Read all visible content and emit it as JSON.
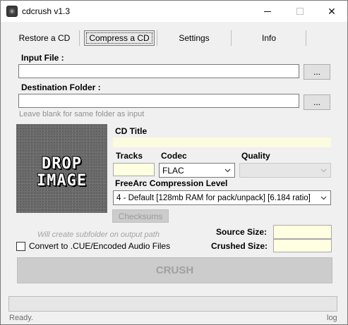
{
  "window": {
    "title": "cdcrush v1.3",
    "close_symbol": "✕"
  },
  "tabs": [
    {
      "label": "Restore a CD",
      "active": false
    },
    {
      "label": "Compress a CD",
      "active": true
    },
    {
      "label": "Settings",
      "active": false
    },
    {
      "label": "Info",
      "active": false
    }
  ],
  "input_file": {
    "label": "Input File :",
    "value": "",
    "browse_label": "..."
  },
  "destination_folder": {
    "label": "Destination Folder :",
    "value": "",
    "browse_label": "...",
    "hint": "Leave blank for same folder as input"
  },
  "drop_image": {
    "text_line1": "DROP",
    "text_line2": "IMAGE"
  },
  "cd_title": {
    "label": "CD Title",
    "value": ""
  },
  "tracks": {
    "label": "Tracks",
    "value": ""
  },
  "codec": {
    "label": "Codec",
    "selected": "FLAC"
  },
  "quality": {
    "label": "Quality",
    "selected": ""
  },
  "compression": {
    "label": "FreeArc Compression Level",
    "selected": "4 - Default [128mb RAM for pack/unpack] [6.184 ratio]"
  },
  "checksums_label": "Checksums",
  "subfolder_hint": "Will create subfolder on output path",
  "convert_checkbox": {
    "label": "Convert to .CUE/Encoded Audio Files",
    "checked": false
  },
  "sizes": {
    "source_label": "Source Size:",
    "source_value": "",
    "crushed_label": "Crushed Size:",
    "crushed_value": ""
  },
  "crush_button_label": "CRUSH",
  "progress": 0,
  "status_text": "Ready.",
  "log_label": "log",
  "colors": {
    "field_yellow": "#ffffe1",
    "disabled_text": "#a0a0a0"
  }
}
